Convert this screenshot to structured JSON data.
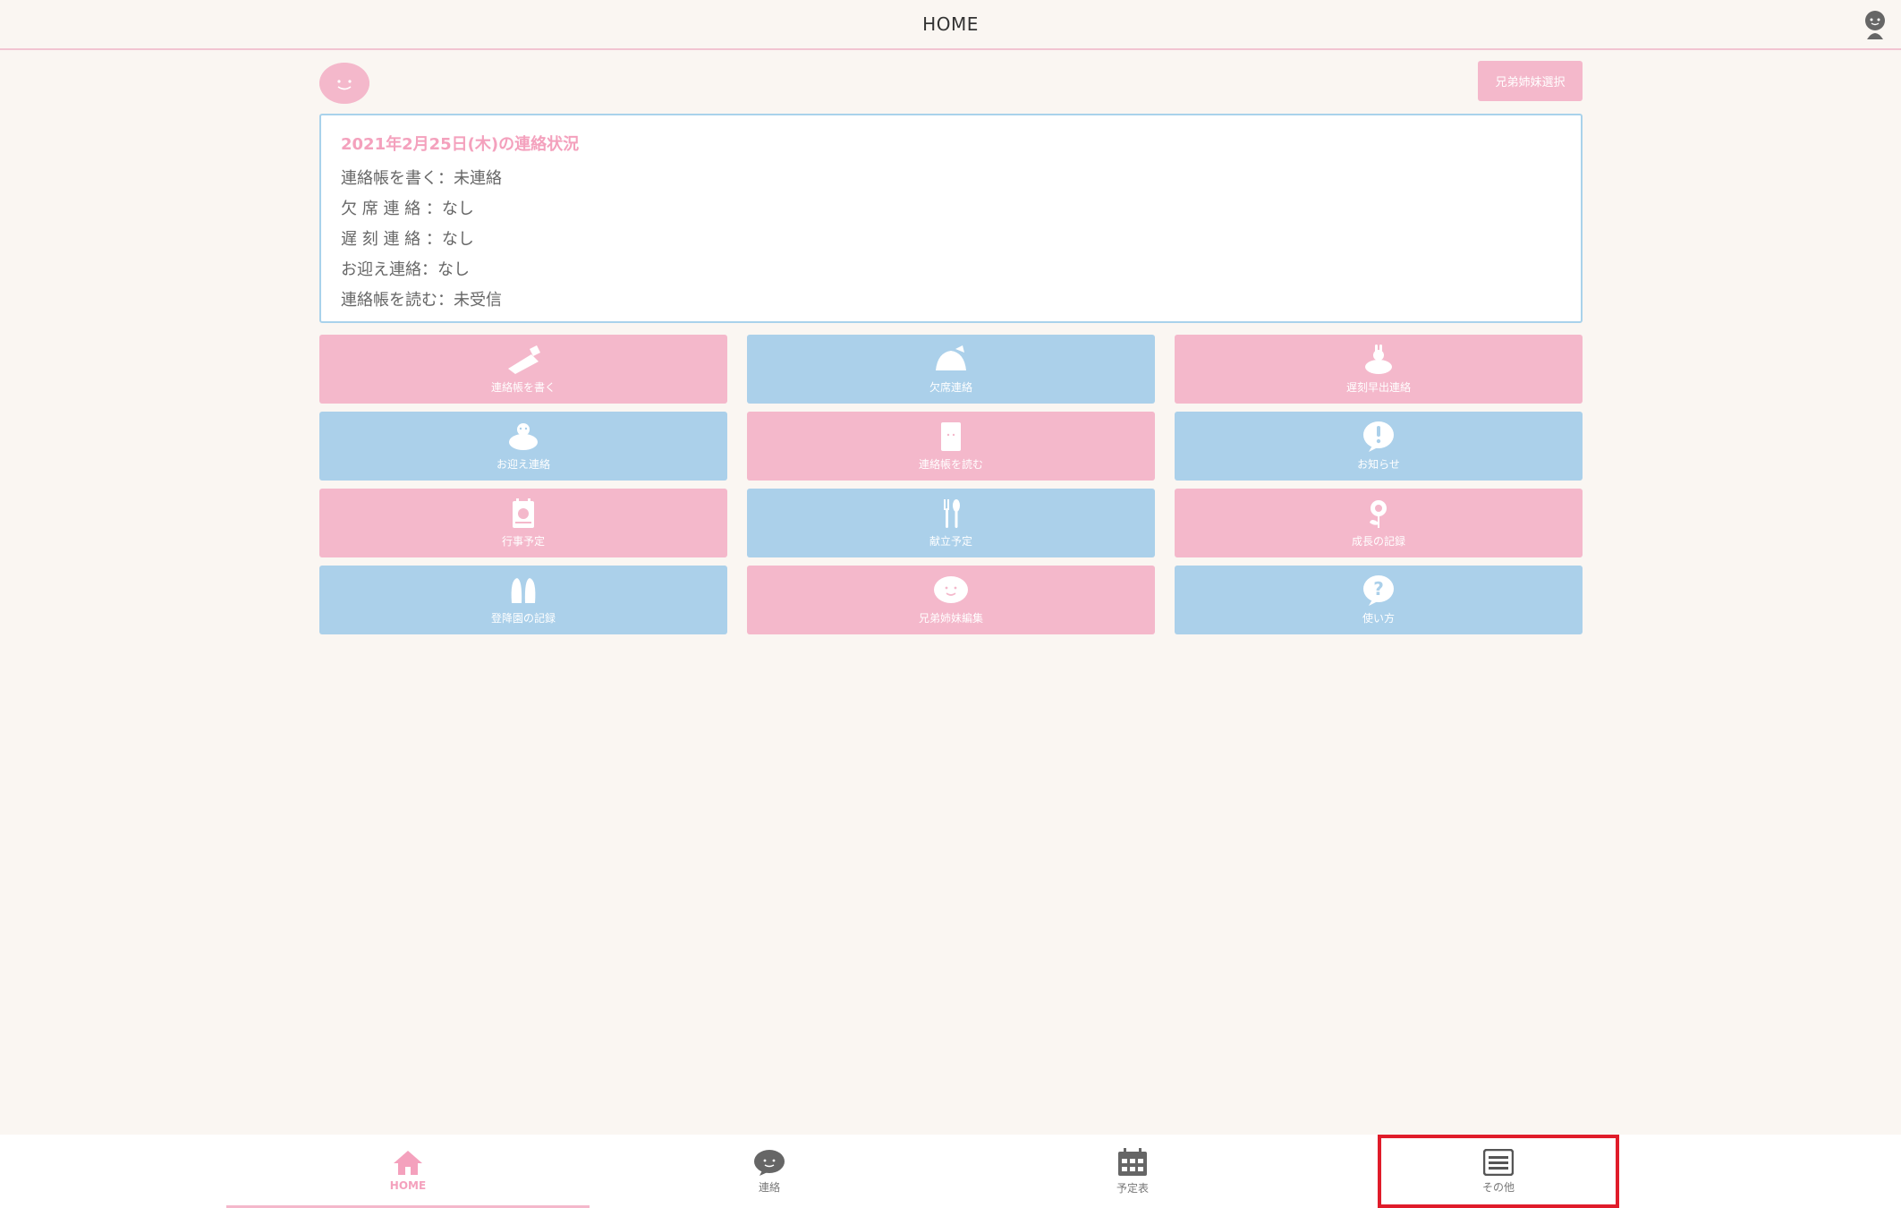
{
  "header": {
    "title": "HOME"
  },
  "child": {
    "sibling_button": "兄弟姉妹選択"
  },
  "status": {
    "title": "2021年2月25日(木)の連絡状況",
    "lines": [
      "連絡帳を書く：未連絡",
      "欠 席 連 絡 ：なし",
      "遅 刻 連 絡 ：なし",
      "お迎え連絡：なし",
      "連絡帳を読む：未受信"
    ]
  },
  "tiles": [
    {
      "label": "連絡帳を書く",
      "icon": "pencil-notebook-icon",
      "color": "pink"
    },
    {
      "label": "欠席連絡",
      "icon": "sleeping-turtle-icon",
      "color": "blue"
    },
    {
      "label": "遅刻早出連絡",
      "icon": "rabbit-on-turtle-icon",
      "color": "pink"
    },
    {
      "label": "お迎え連絡",
      "icon": "turtle-icon",
      "color": "blue"
    },
    {
      "label": "連絡帳を読む",
      "icon": "notebook-icon",
      "color": "pink"
    },
    {
      "label": "お知らせ",
      "icon": "exclamation-bubble-icon",
      "color": "blue"
    },
    {
      "label": "行事予定",
      "icon": "calendar-icon",
      "color": "pink"
    },
    {
      "label": "献立予定",
      "icon": "fork-spoon-icon",
      "color": "blue"
    },
    {
      "label": "成長の記録",
      "icon": "flower-icon",
      "color": "pink"
    },
    {
      "label": "登降園の記録",
      "icon": "shoes-icon",
      "color": "blue"
    },
    {
      "label": "兄弟姉妹編集",
      "icon": "smile-bubble-icon",
      "color": "pink"
    },
    {
      "label": "使い方",
      "icon": "question-bubble-icon",
      "color": "blue"
    }
  ],
  "nav": {
    "home": "HOME",
    "contact": "連絡",
    "schedule": "予定表",
    "other": "その他"
  },
  "colors": {
    "pink": "#f4b8cb",
    "blue": "#abd0ea",
    "highlight": "#e01c2a"
  }
}
